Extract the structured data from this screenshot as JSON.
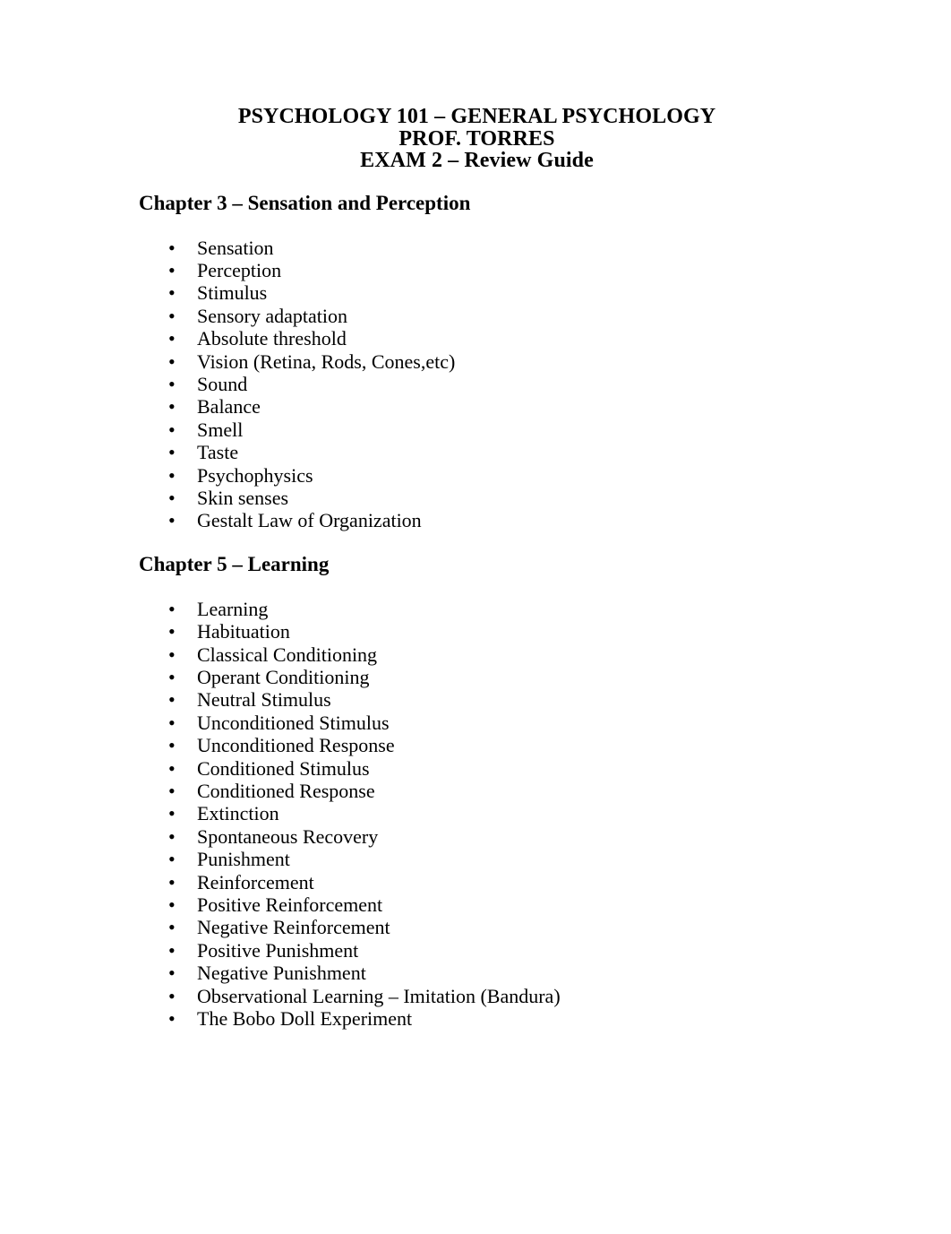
{
  "document": {
    "background_color": "#ffffff",
    "text_color": "#000000",
    "bullet_glyph": "•"
  },
  "title": {
    "line1": "PSYCHOLOGY 101 – GENERAL PSYCHOLOGY",
    "line2": "PROF. TORRES",
    "line3": "EXAM 2 – Review Guide"
  },
  "sections": [
    {
      "heading": "Chapter 3 – Sensation and Perception",
      "items": [
        "Sensation",
        "Perception",
        "Stimulus",
        "Sensory adaptation",
        "Absolute threshold",
        "Vision (Retina, Rods, Cones,etc)",
        "Sound",
        "Balance",
        "Smell",
        "Taste",
        "Psychophysics",
        "Skin senses",
        "Gestalt Law of Organization"
      ]
    },
    {
      "heading": "Chapter 5 – Learning",
      "items": [
        "Learning",
        "Habituation",
        "Classical Conditioning",
        "Operant Conditioning",
        "Neutral Stimulus",
        "Unconditioned Stimulus",
        "Unconditioned Response",
        "Conditioned Stimulus",
        "Conditioned Response",
        "Extinction",
        "Spontaneous Recovery",
        "Punishment",
        "Reinforcement",
        "Positive Reinforcement",
        "Negative Reinforcement",
        "Positive Punishment",
        "Negative Punishment",
        "Observational Learning – Imitation (Bandura)",
        "The Bobo Doll Experiment"
      ]
    }
  ]
}
